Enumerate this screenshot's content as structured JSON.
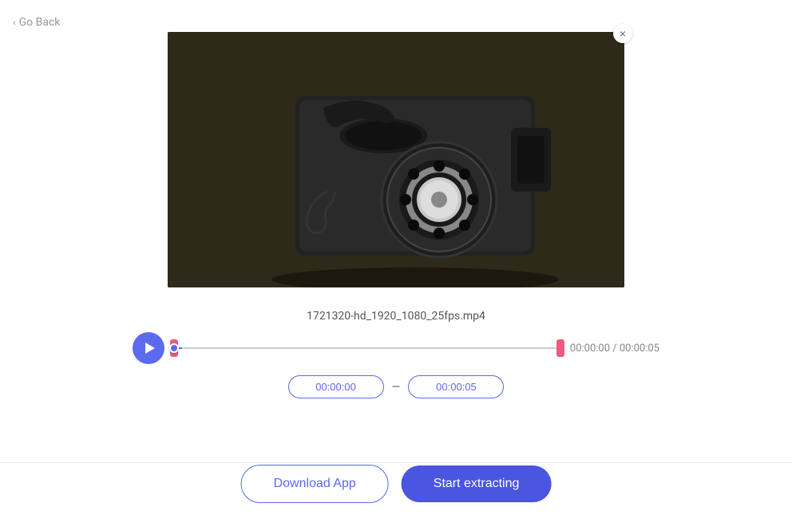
{
  "nav": {
    "go_back_label": "Go Back"
  },
  "video": {
    "filename": "1721320-hd_1920_1080_25fps.mp4",
    "close_label": "×"
  },
  "player": {
    "current_time": "00:00:00",
    "total_time": "00:00:05",
    "time_display": "00:00:00 / 00:00:05",
    "range_start": "00:00:00",
    "range_end": "00:00:05"
  },
  "buttons": {
    "download_label": "Download App",
    "extract_label": "Start extracting"
  }
}
